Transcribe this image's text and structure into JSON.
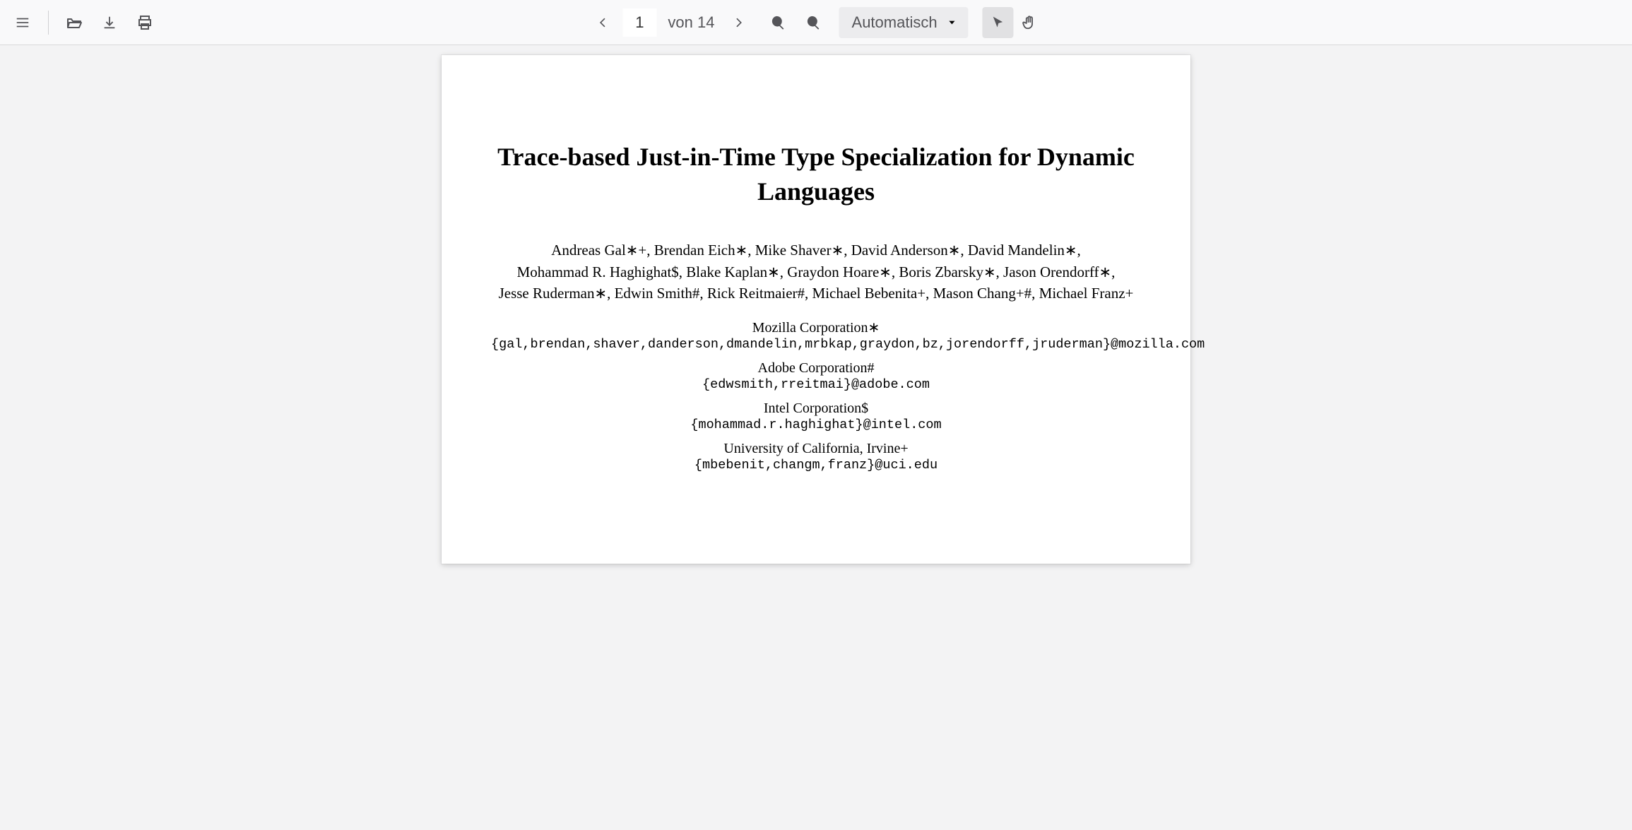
{
  "toolbar": {
    "menu_icon": "menu",
    "open_icon": "open-file",
    "download_icon": "download",
    "print_icon": "print",
    "prev_icon": "chevron-left",
    "next_icon": "chevron-right",
    "page_current": "1",
    "page_of_prefix": "von",
    "page_total": "14",
    "zoom_out_icon": "zoom-out",
    "zoom_in_icon": "zoom-in",
    "zoom_label": "Automatisch",
    "cursor_tool": "text-select",
    "hand_tool": "hand"
  },
  "paper": {
    "title": "Trace-based Just-in-Time Type Specialization for Dynamic Languages",
    "authors_line1": "Andreas Gal∗+, Brendan Eich∗, Mike Shaver∗, David Anderson∗, David Mandelin∗,",
    "authors_line2": "Mohammad R. Haghighat$, Blake Kaplan∗, Graydon Hoare∗, Boris Zbarsky∗, Jason Orendorff∗,",
    "authors_line3": "Jesse Ruderman∗, Edwin Smith#, Rick Reitmaier#, Michael Bebenita+, Mason Chang+#, Michael Franz+",
    "affiliations": [
      {
        "name": "Mozilla Corporation∗",
        "email": "{gal,brendan,shaver,danderson,dmandelin,mrbkap,graydon,bz,jorendorff,jruderman}@mozilla.com"
      },
      {
        "name": "Adobe Corporation#",
        "email": "{edwsmith,rreitmai}@adobe.com"
      },
      {
        "name": "Intel Corporation$",
        "email": "{mohammad.r.haghighat}@intel.com"
      },
      {
        "name": "University of California, Irvine+",
        "email": "{mbebenit,changm,franz}@uci.edu"
      }
    ]
  }
}
